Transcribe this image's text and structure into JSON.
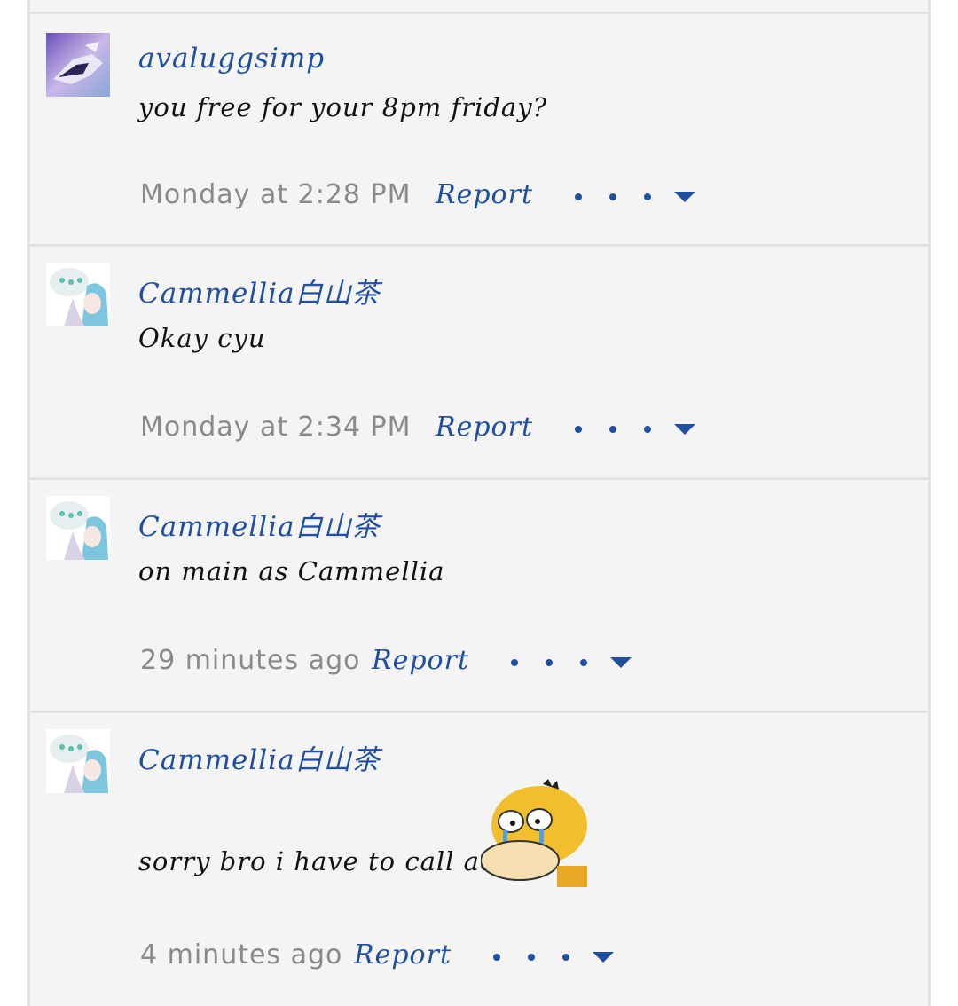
{
  "messages": [
    {
      "username": "avaluggsimp",
      "text": "you free for your 8pm friday?",
      "time": "Monday at 2:28 PM",
      "report": "Report"
    },
    {
      "username": "Cammellia白山茶",
      "text": "Okay cyu",
      "time": "Monday at 2:34 PM",
      "report": "Report"
    },
    {
      "username": "Cammellia白山茶",
      "text": "on main as Cammellia",
      "time": "29 minutes ago",
      "report": "Report"
    },
    {
      "username": "Cammellia白山茶",
      "text": "sorry bro i have to call act",
      "time": "4 minutes ago",
      "report": "Report"
    }
  ],
  "icons": {
    "more_actions": "more-dots-icon",
    "expand": "chevron-down-icon"
  },
  "colors": {
    "accent": "#1f4fa3",
    "text": "#111111",
    "muted": "#8a8a8a",
    "background": "#f4f4f4",
    "divider": "#e2e2e2"
  }
}
